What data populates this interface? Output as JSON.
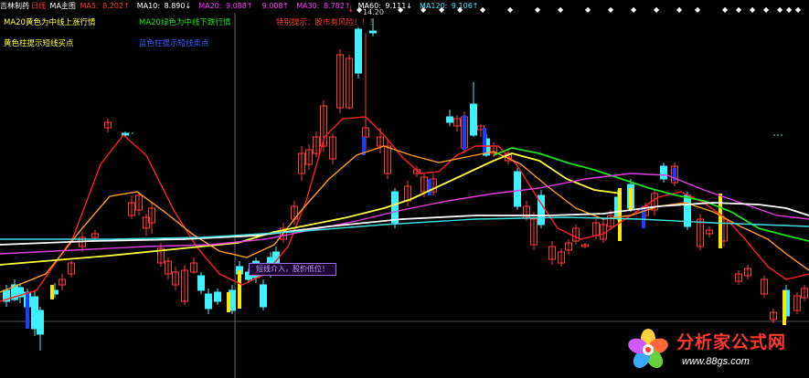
{
  "header": {
    "stock": "吉林制药",
    "period": "日线",
    "chart_type": "MA主图",
    "ma_items": [
      {
        "label": "MA5",
        "value": "8.202",
        "arrow": "↑",
        "color": "#ff3b3b",
        "value_color": "#ff3b3b"
      },
      {
        "label": "MA10",
        "value": "8.890",
        "arrow": "↓",
        "color": "#ffffff",
        "value_color": "#ffffff"
      },
      {
        "label": "MA20",
        "value": "9.088",
        "arrow": "↑",
        "color": "#ff3bff",
        "value_color": "#ff3bff"
      },
      {
        "label": "",
        "value": "9.008",
        "arrow": "↑",
        "color": "#ff3bff",
        "value_color": "#ff3bff"
      },
      {
        "label": "MA30",
        "value": "8.782",
        "arrow": "↑",
        "color": "#ff3bff",
        "value_color": "#ff3bff"
      },
      {
        "label": "MA60",
        "value": "9.111",
        "arrow": "↓",
        "color": "#ffffff",
        "value_color": "#ffffff"
      },
      {
        "label": "MA120",
        "value": "9.106",
        "arrow": "↑",
        "color": "#3ff0ff",
        "value_color": "#3ff0ff"
      }
    ]
  },
  "notes": {
    "ma20_yellow": "MA20黄色为中线上涨行情",
    "ma20_green": "MA20绿色为中线下跌行情",
    "special_tip": "特别提示：股市有风险！！！",
    "yellow_bar": "黄色柱提示短线买点",
    "blue_bar": "蓝色柱提示短线卖点"
  },
  "price_label": "14.20",
  "signal_box": "短线介入，股价低位！",
  "logo": {
    "title": "分析家公式网",
    "url": "www.88gs.com"
  },
  "colors": {
    "background": "#000000",
    "up_candle": "#ff3b3b",
    "down_candle": "#3ff0ff",
    "buy_bar": "#ffe800",
    "sell_bar": "#1a3cff",
    "ma5": "#ff2020",
    "ma10": "#ff9a20",
    "ma20_up": "#ffff40",
    "ma20_down": "#20e020",
    "ma30": "#e040e0",
    "ma60": "#ffffff",
    "ma120": "#40e0e0"
  }
}
